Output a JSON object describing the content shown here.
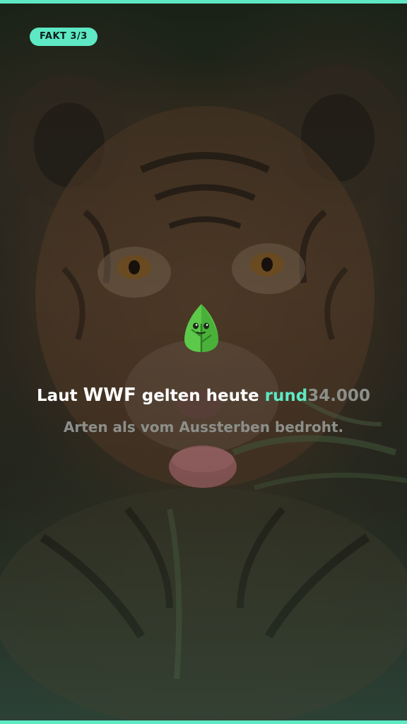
{
  "badge": {
    "label": "FAKT 3/3"
  },
  "colors": {
    "accent": "#5ee8c4",
    "dim_text": "#8c8f8a",
    "text": "#ffffff"
  },
  "mascot": {
    "icon": "leaf-mascot-icon"
  },
  "caption": {
    "line1": {
      "w1": "Laut",
      "w2": "WWF",
      "w3": "gelten heute",
      "w4": "rund",
      "w5": "34.000"
    },
    "line2": "Arten als vom Aussterben bedroht."
  },
  "background": {
    "subject": "tiger-cub-photo"
  }
}
